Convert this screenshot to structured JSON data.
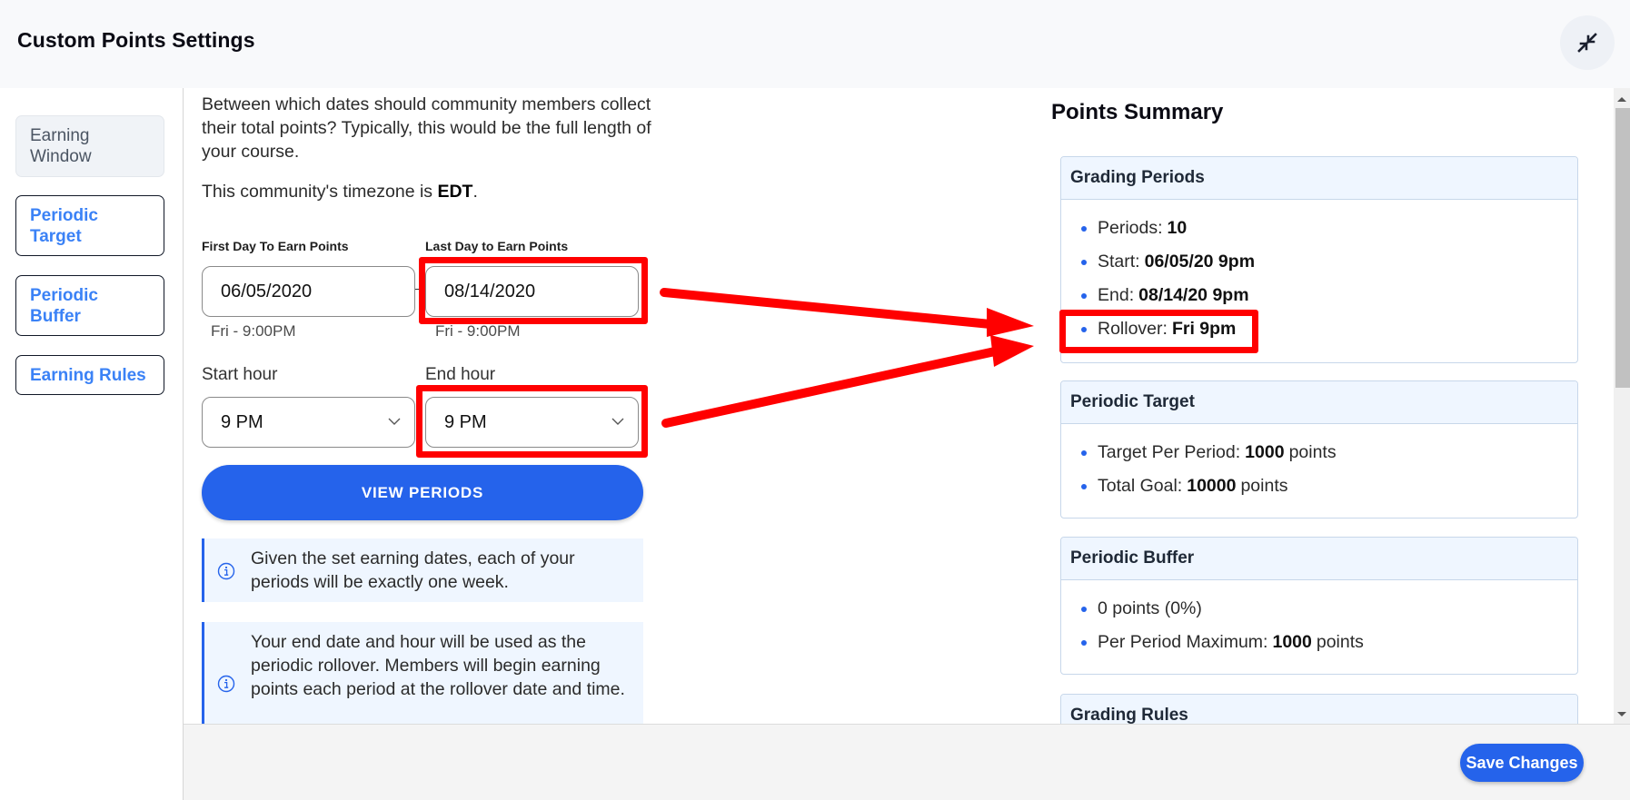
{
  "header": {
    "title": "Custom Points Settings",
    "collapse_icon": "collapse-arrows-icon"
  },
  "sidebar": {
    "items": [
      {
        "label": "Earning Window",
        "active": true
      },
      {
        "label": "Periodic Target",
        "active": false
      },
      {
        "label": "Periodic Buffer",
        "active": false
      },
      {
        "label": "Earning Rules",
        "active": false
      }
    ]
  },
  "earning_window": {
    "intro": "Between which dates should community members collect their total points? Typically, this would be the full length of your course.",
    "timezone_prefix": "This community's timezone is ",
    "timezone": "EDT",
    "timezone_suffix": ".",
    "first_day": {
      "label": "First Day To Earn Points",
      "value": "06/05/2020",
      "hint": "Fri - 9:00PM"
    },
    "last_day": {
      "label": "Last Day to Earn Points",
      "value": "08/14/2020",
      "hint": "Fri - 9:00PM"
    },
    "start_hour": {
      "label": "Start hour",
      "value": "9 PM"
    },
    "end_hour": {
      "label": "End hour",
      "value": "9 PM"
    },
    "view_periods_label": "VIEW PERIODS",
    "info": [
      "Given the set earning dates, each of your periods will be exactly one week.",
      "Your end date and hour will be used as the periodic rollover. Members will begin earning points each period at the rollover date and time."
    ]
  },
  "summary": {
    "title": "Points Summary",
    "cards": [
      {
        "title": "Grading Periods",
        "items": [
          {
            "label": "Periods:",
            "value": "10",
            "suffix": ""
          },
          {
            "label": "Start:",
            "value": "06/05/20 9pm",
            "suffix": ""
          },
          {
            "label": "End:",
            "value": "08/14/20 9pm",
            "suffix": ""
          },
          {
            "label": "Rollover:",
            "value": "Fri 9pm",
            "suffix": ""
          }
        ]
      },
      {
        "title": "Periodic Target",
        "items": [
          {
            "label": "Target Per Period:",
            "value": "1000",
            "suffix": "points"
          },
          {
            "label": "Total Goal:",
            "value": "10000",
            "suffix": "points"
          }
        ]
      },
      {
        "title": "Periodic Buffer",
        "items": [
          {
            "label": "0 points (0%)",
            "value": "",
            "suffix": ""
          },
          {
            "label": "Per Period Maximum:",
            "value": "1000",
            "suffix": "points"
          }
        ]
      },
      {
        "title": "Grading Rules",
        "items": []
      }
    ]
  },
  "footer": {
    "save_label": "Save Changes"
  },
  "colors": {
    "accent": "#2563eb",
    "link": "#3b82f6",
    "annotation": "#ff0000",
    "card_header_bg": "#eff6ff"
  }
}
